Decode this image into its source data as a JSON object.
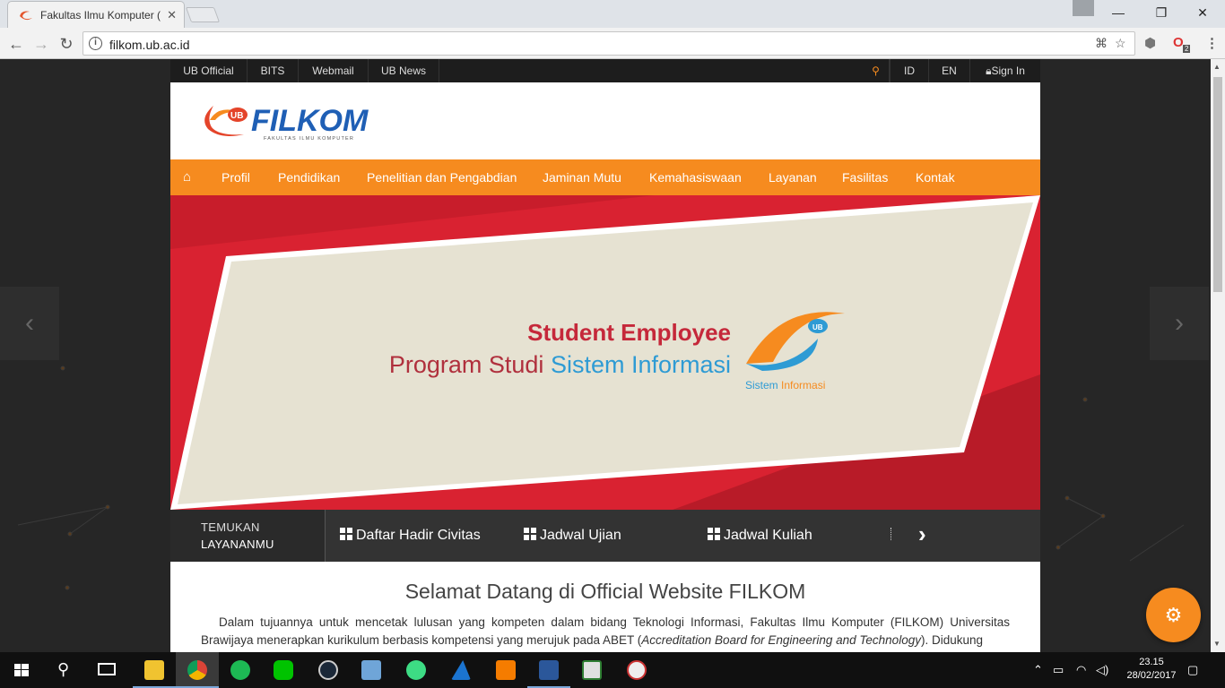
{
  "browser": {
    "tab_title": "Fakultas Ilmu Komputer (",
    "url": "filkom.ub.ac.id",
    "extension_badge": "2"
  },
  "topbar": {
    "links": [
      "UB Official",
      "BITS",
      "Webmail",
      "UB News"
    ],
    "lang": [
      "ID",
      "EN"
    ],
    "signin": "Sign In"
  },
  "logo": {
    "badge": "UB",
    "name": "FILKOM",
    "tagline": "FAKULTAS ILMU KOMPUTER"
  },
  "nav": {
    "items": [
      "Profil",
      "Pendidikan",
      "Penelitian dan Pengabdian",
      "Jaminan Mutu",
      "Kemahasiswaan",
      "Layanan",
      "Fasilitas",
      "Kontak"
    ]
  },
  "banner": {
    "line1": "Student Employee",
    "line2a": "Program Studi ",
    "line2b": "Sistem Informasi",
    "logo_badge": "UB",
    "logo_caption_a": "Sistem ",
    "logo_caption_b": "Informasi"
  },
  "services": {
    "label_top": "TEMUKAN",
    "label_bottom": "LAYANANMU",
    "items": [
      "Daftar Hadir Civitas",
      "Jadwal Ujian",
      "Jadwal Kuliah"
    ]
  },
  "content": {
    "heading": "Selamat Datang di Official Website FILKOM",
    "para_a": "Dalam tujuannya untuk mencetak lulusan yang kompeten dalam bidang Teknologi Informasi, Fakultas Ilmu Komputer (FILKOM) Universitas Brawijaya menerapkan kurikulum berbasis kompetensi yang merujuk pada ABET (",
    "para_em": "Accreditation Board for Engineering and Technology",
    "para_b": "). Didukung"
  },
  "taskbar": {
    "time": "23.15",
    "date": "28/02/2017"
  },
  "colors": {
    "accent_orange": "#f68b1f",
    "banner_red": "#d92231",
    "banner_cream": "#e6e2d2",
    "text_blue": "#2e9bd4"
  }
}
